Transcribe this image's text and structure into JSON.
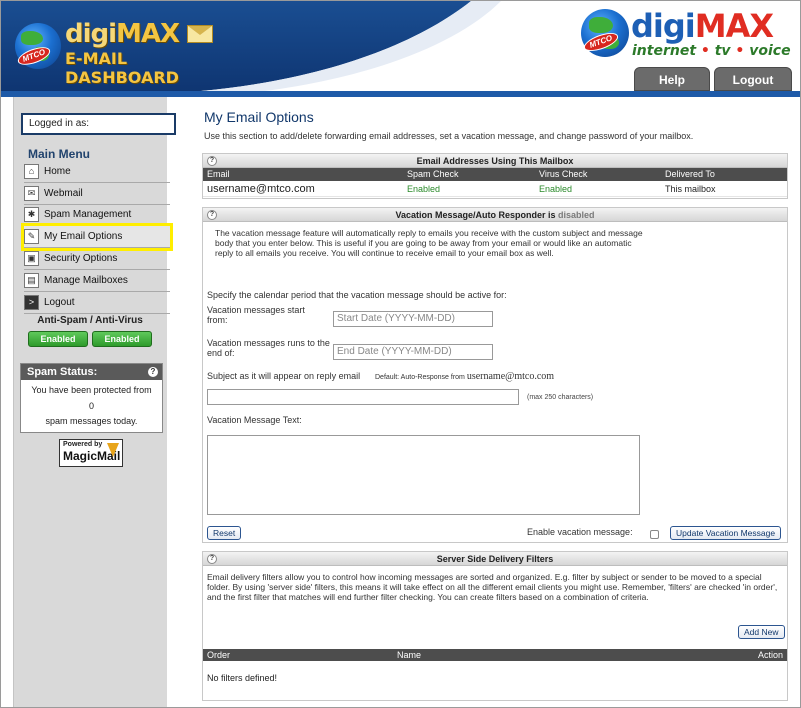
{
  "header": {
    "left_logo_badge": "MTCO",
    "left_logo_title_a": "digi",
    "left_logo_title_b": "MAX",
    "left_logo_subtitle": "E-MAIL DASHBOARD",
    "right_logo_badge": "MTCO",
    "right_logo_title_a": "digi",
    "right_logo_title_b": "MAX",
    "right_tag_1": "internet",
    "right_tag_sep": " • ",
    "right_tag_2": "tv",
    "right_tag_3": "voice",
    "nav": [
      {
        "label": "Help"
      },
      {
        "label": "Logout"
      }
    ]
  },
  "sidebar": {
    "logged_in_label": "Logged in as:",
    "menu_title": "Main Menu",
    "items": [
      {
        "label": "Home",
        "icon": "home-icon"
      },
      {
        "label": "Webmail",
        "icon": "mail-icon"
      },
      {
        "label": "Spam Management",
        "icon": "bug-icon"
      },
      {
        "label": "My Email Options",
        "icon": "wrench-icon"
      },
      {
        "label": "Security Options",
        "icon": "lock-icon"
      },
      {
        "label": "Manage Mailboxes",
        "icon": "mailboxes-icon"
      },
      {
        "label": "Logout",
        "icon": "exit-icon"
      }
    ],
    "antispam_title": "Anti-Spam / Anti-Virus",
    "antispam_btn": "Enabled",
    "antivirus_btn": "Enabled",
    "spam_status_title": "Spam Status:",
    "spam_line1": "You have been protected from",
    "spam_count": "0",
    "spam_line3": "spam messages today.",
    "powered_by": "Powered by",
    "powered_brand": "MagicMail"
  },
  "main": {
    "title": "My Email Options",
    "description": "Use this section to add/delete forwarding email addresses, set a vacation message, and change password of your mailbox.",
    "addresses": {
      "heading": "Email Addresses Using This Mailbox",
      "columns": [
        "Email",
        "Spam Check",
        "Virus Check",
        "Delivered To"
      ],
      "rows": [
        {
          "email": "username@mtco.com",
          "spam": "Enabled",
          "virus": "Enabled",
          "delivered": "This mailbox"
        }
      ]
    },
    "vacation": {
      "heading_prefix": "Vacation Message/Auto Responder is ",
      "heading_status": "disabled",
      "intro": "The vacation message feature will automatically reply to emails you receive with the custom subject and message body that you enter below. This is useful if you are going to be away from your email or would like an automatic reply to all emails you receive. You will continue to receive email to your email box as well.",
      "period_label": "Specify the calendar period that the vacation message should be active for:",
      "start_label": "Vacation messages start from:",
      "start_placeholder": "Start Date (YYYY-MM-DD)",
      "end_label": "Vacation messages runs to the end of:",
      "end_placeholder": "End Date (YYYY-MM-DD)",
      "subject_label": "Subject as it will appear on reply email",
      "subject_default_prefix": "Default: Auto-Response from ",
      "subject_default_email": "username@mtco.com",
      "subject_value": "",
      "subject_note": "(max 250 characters)",
      "message_label": "Vacation Message Text:",
      "message_value": "",
      "reset_label": "Reset",
      "enable_label": "Enable vacation message:",
      "update_label": "Update Vacation Message"
    },
    "filters": {
      "heading": "Server Side Delivery Filters",
      "text": "Email delivery filters allow you to control how incoming messages are sorted and organized. E.g. filter by subject or sender to be moved to a special folder. By using 'server side' filters, this means it will take effect on all the different email clients you might use. Remember, 'filters' are checked 'in order', and the first filter that matches will end further filter checking. You can create filters based on a combination of criteria.",
      "add_label": "Add New",
      "columns": [
        "Order",
        "Name",
        "Action"
      ],
      "empty": "No filters defined!"
    }
  }
}
